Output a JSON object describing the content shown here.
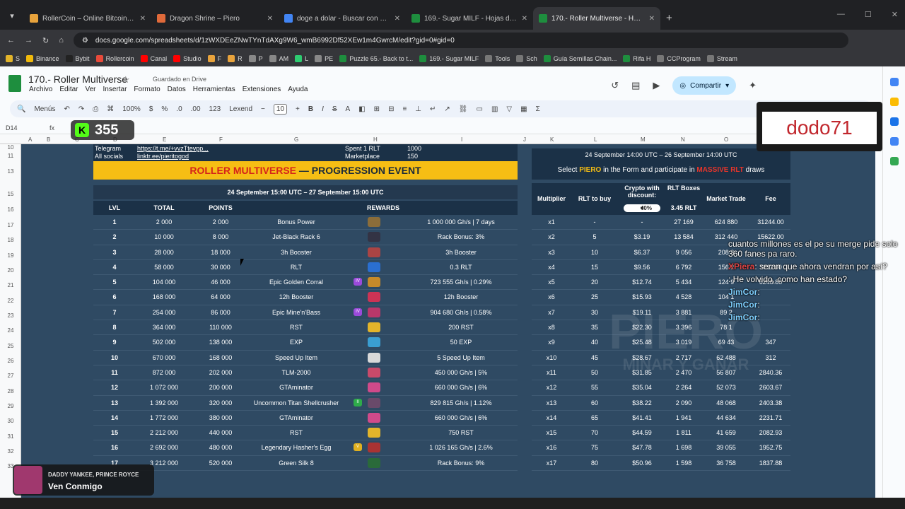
{
  "browser": {
    "tabs": [
      {
        "title": "RollerCoin – Online Bitcoin Mining",
        "color": "#e8a33c"
      },
      {
        "title": "Dragon Shrine – Piero",
        "color": "#e06a3a"
      },
      {
        "title": "doge a dolar - Buscar con Google",
        "color": "#4285f4"
      },
      {
        "title": "169.- Sugar MILF - Hojas de cálculo",
        "color": "#1e8e3e"
      },
      {
        "title": "170.- Roller Multiverse - Hojas de c",
        "color": "#1e8e3e"
      }
    ],
    "url": "docs.google.com/spreadsheets/d/1zWXDEeZNwTYnTdAXg9W6_wmB6992Df52XEw1m4GwrcM/edit?gid=0#gid=0",
    "bookmarks": [
      "S",
      "Binance",
      "Bybit",
      "Rollercoin",
      "Canal",
      "Studio",
      "F",
      "R",
      "P",
      "AM",
      "L",
      "PE",
      "Puzzle 65.- Back to t...",
      "169.- Sugar MILF",
      "Tools",
      "Sch",
      "Guía Semillas Chain...",
      "Rifa H",
      "CCProgram",
      "Stream"
    ]
  },
  "sheets": {
    "title": "170.- Roller Multiverse",
    "saved_status": "Guardado en Drive",
    "menus": [
      "Archivo",
      "Editar",
      "Ver",
      "Insertar",
      "Formato",
      "Datos",
      "Herramientas",
      "Extensiones",
      "Ayuda"
    ],
    "share_label": "Compartir",
    "toolbar": {
      "menus": "Menús",
      "zoom": "100%",
      "currency": "$",
      "percent": "%",
      "dec_less": ".0",
      "dec_more": ".00",
      "number": "123",
      "font": "Lexend",
      "font_size": "10"
    },
    "cell_ref": "D14",
    "columns": [
      "A",
      "B",
      "C",
      "D",
      "E",
      "F",
      "G",
      "H",
      "I",
      "J",
      "K",
      "L",
      "M",
      "N",
      "O",
      "P",
      "Q",
      "R"
    ],
    "row_numbers": [
      "10",
      "11",
      "13",
      "15",
      "16",
      "17",
      "18",
      "19",
      "20",
      "21",
      "22",
      "23",
      "24",
      "25",
      "26",
      "27",
      "28",
      "29",
      "30",
      "31",
      "32",
      "33"
    ]
  },
  "left_table": {
    "info_rows": [
      {
        "label": "Telegram",
        "value": "https://t.me/+vvzTtevpp...",
        "right_label": "Spent 1 RLT",
        "right_value": "1000"
      },
      {
        "label": "All socials",
        "value": "linktr.ee/pieritogod",
        "right_label": "Marketplace",
        "right_value": "150"
      }
    ],
    "banner_red": "ROLLER MULTIVERSE",
    "banner_dash": " — ",
    "banner_dark": "PROGRESSION EVENT",
    "event_dates": "24 September 15:00 UTC – 27 September 15:00 UTC",
    "headers": {
      "lvl": "LVL",
      "total": "TOTAL",
      "points": "POINTS",
      "rewards": "REWARDS"
    },
    "rows": [
      {
        "lvl": "1",
        "total": "2 000",
        "points": "2 000",
        "reward": "Bonus Power",
        "detail": "1 000 000 Gh/s | 7 days",
        "icon": "#8b6d3a",
        "badge": ""
      },
      {
        "lvl": "2",
        "total": "10 000",
        "points": "8 000",
        "reward": "Jet-Black Rack 6",
        "detail": "Rack Bonus: 3%",
        "icon": "#334",
        "badge": ""
      },
      {
        "lvl": "3",
        "total": "28 000",
        "points": "18 000",
        "reward": "3h Booster",
        "detail": "3h Booster",
        "icon": "#aa4444",
        "badge": ""
      },
      {
        "lvl": "4",
        "total": "58 000",
        "points": "30 000",
        "reward": "RLT",
        "detail": "0.3 RLT",
        "icon": "#2a6fd1",
        "badge": ""
      },
      {
        "lvl": "5",
        "total": "104 000",
        "points": "46 000",
        "reward": "Epic Golden Corral",
        "detail": "723 555 Gh/s | 0.29%",
        "icon": "#c68a2a",
        "badge": "IV"
      },
      {
        "lvl": "6",
        "total": "168 000",
        "points": "64 000",
        "reward": "12h Booster",
        "detail": "12h Booster",
        "icon": "#cc3355",
        "badge": ""
      },
      {
        "lvl": "7",
        "total": "254 000",
        "points": "86 000",
        "reward": "Epic Mine'n'Bass",
        "detail": "904 680 Gh/s | 0.58%",
        "icon": "#b9386a",
        "badge": "IV"
      },
      {
        "lvl": "8",
        "total": "364 000",
        "points": "110 000",
        "reward": "RST",
        "detail": "200 RST",
        "icon": "#e2b42a",
        "badge": ""
      },
      {
        "lvl": "9",
        "total": "502 000",
        "points": "138 000",
        "reward": "EXP",
        "detail": "50 EXP",
        "icon": "#3a9ed1",
        "badge": ""
      },
      {
        "lvl": "10",
        "total": "670 000",
        "points": "168 000",
        "reward": "Speed Up Item",
        "detail": "5 Speed Up Item",
        "icon": "#d9d9d9",
        "badge": ""
      },
      {
        "lvl": "11",
        "total": "872 000",
        "points": "202 000",
        "reward": "TLM-2000",
        "detail": "450 000 Gh/s | 5%",
        "icon": "#c94a6a",
        "badge": ""
      },
      {
        "lvl": "12",
        "total": "1 072 000",
        "points": "200 000",
        "reward": "GTAminator",
        "detail": "660 000 Gh/s | 6%",
        "icon": "#d04a8a",
        "badge": ""
      },
      {
        "lvl": "13",
        "total": "1 392 000",
        "points": "320 000",
        "reward": "Uncommon Titan Shellcrusher",
        "detail": "829 815 Gh/s | 1.12%",
        "icon": "#6a4a6a",
        "badge": "II"
      },
      {
        "lvl": "14",
        "total": "1 772 000",
        "points": "380 000",
        "reward": "GTAminator",
        "detail": "660 000 Gh/s | 6%",
        "icon": "#d04a8a",
        "badge": ""
      },
      {
        "lvl": "15",
        "total": "2 212 000",
        "points": "440 000",
        "reward": "RST",
        "detail": "750 RST",
        "icon": "#e2b42a",
        "badge": ""
      },
      {
        "lvl": "16",
        "total": "2 692 000",
        "points": "480 000",
        "reward": "Legendary Hasher's Egg",
        "detail": "1 026 165 Gh/s | 2.6%",
        "icon": "#a33",
        "badge": "V"
      },
      {
        "lvl": "17",
        "total": "3 212 000",
        "points": "520 000",
        "reward": "Green Silk 8",
        "detail": "Rack Bonus: 9%",
        "icon": "#2a6a3a",
        "badge": ""
      }
    ]
  },
  "right_table": {
    "top_dates": "24 September 14:00 UTC – 26 September 14:00 UTC",
    "select_pre": "Select ",
    "select_name": "PIERO",
    "select_mid": " in the Form and participate in ",
    "select_massive": "MASSIVE RLT",
    "select_end": " draws",
    "headers": {
      "multiplier": "Multiplier",
      "rlt_to_buy": "RLT to buy",
      "crypto": "Crypto with discount:",
      "discount": "40%",
      "rlt_boxes": "RLT Boxes",
      "rlt_boxes_val": "3.45 RLT",
      "market": "Market Trade",
      "fee": "Fee"
    },
    "rows": [
      {
        "m": "x1",
        "rlt": "-",
        "crypto": "-",
        "boxes": "27 169",
        "market": "624 880",
        "fee": "31244.00"
      },
      {
        "m": "x2",
        "rlt": "5",
        "crypto": "$3.19",
        "boxes": "13 584",
        "market": "312 440",
        "fee": "15622.00"
      },
      {
        "m": "x3",
        "rlt": "10",
        "crypto": "$6.37",
        "boxes": "9 056",
        "market": "208 2",
        "fee": ""
      },
      {
        "m": "x4",
        "rlt": "15",
        "crypto": "$9.56",
        "boxes": "6 792",
        "market": "156 2",
        "fee": "7811.00"
      },
      {
        "m": "x5",
        "rlt": "20",
        "crypto": "$12.74",
        "boxes": "5 434",
        "market": "124 9",
        "fee": "6248.80"
      },
      {
        "m": "x6",
        "rlt": "25",
        "crypto": "$15.93",
        "boxes": "4 528",
        "market": "104 1",
        "fee": ""
      },
      {
        "m": "x7",
        "rlt": "30",
        "crypto": "$19.11",
        "boxes": "3 881",
        "market": "89 2",
        "fee": ""
      },
      {
        "m": "x8",
        "rlt": "35",
        "crypto": "$22.30",
        "boxes": "3 396",
        "market": "78 1",
        "fee": ""
      },
      {
        "m": "x9",
        "rlt": "40",
        "crypto": "$25.48",
        "boxes": "3 019",
        "market": "69 43",
        "fee": "347"
      },
      {
        "m": "x10",
        "rlt": "45",
        "crypto": "$28.67",
        "boxes": "2 717",
        "market": "62 488",
        "fee": "312"
      },
      {
        "m": "x11",
        "rlt": "50",
        "crypto": "$31.85",
        "boxes": "2 470",
        "market": "56 807",
        "fee": "2840.36"
      },
      {
        "m": "x12",
        "rlt": "55",
        "crypto": "$35.04",
        "boxes": "2 264",
        "market": "52 073",
        "fee": "2603.67"
      },
      {
        "m": "x13",
        "rlt": "60",
        "crypto": "$38.22",
        "boxes": "2 090",
        "market": "48 068",
        "fee": "2403.38"
      },
      {
        "m": "x14",
        "rlt": "65",
        "crypto": "$41.41",
        "boxes": "1 941",
        "market": "44 634",
        "fee": "2231.71"
      },
      {
        "m": "x15",
        "rlt": "70",
        "crypto": "$44.59",
        "boxes": "1 811",
        "market": "41 659",
        "fee": "2082.93"
      },
      {
        "m": "x16",
        "rlt": "75",
        "crypto": "$47.78",
        "boxes": "1 698",
        "market": "39 055",
        "fee": "1952.75"
      },
      {
        "m": "x17",
        "rlt": "80",
        "crypto": "$50.96",
        "boxes": "1 598",
        "market": "36 758",
        "fee": "1837.88"
      }
    ]
  },
  "overlays": {
    "kick_count": "355",
    "streamer_name": "dodo71",
    "watermark_main": "PIERO",
    "watermark_sub": "MINAR Y GANAR",
    "chat": [
      {
        "user": "",
        "text": "cuantos millones es el pe su merge pide solo 360 fanes pa raro."
      },
      {
        "user": "XPiera",
        "text": ": seran que ahora vendran por así?"
      },
      {
        "user": "",
        "text": ": He volvido, como han estado?"
      },
      {
        "user": "JimCor",
        "text": ":"
      },
      {
        "user": "JimCor",
        "text": ":"
      },
      {
        "user": "JimCor",
        "text": ":"
      }
    ],
    "music_artist": "DADDY YANKEE, PRINCE ROYCE",
    "music_title": "Ven Conmigo"
  }
}
